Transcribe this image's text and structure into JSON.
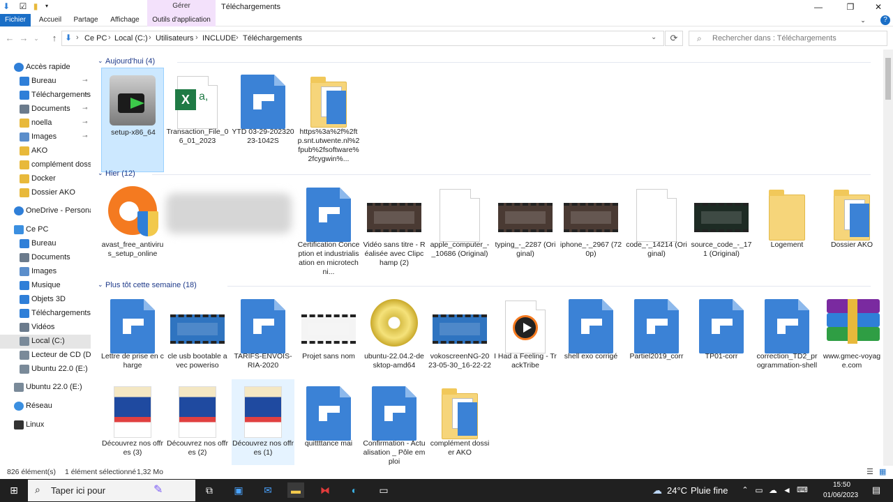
{
  "window": {
    "title": "Téléchargements",
    "context_group": "Gérer",
    "controls": {
      "minimize": "—",
      "maximize": "❐",
      "close": "✕"
    }
  },
  "ribbon": {
    "tabs": [
      "Fichier",
      "Accueil",
      "Partage",
      "Affichage",
      "Outils d'application"
    ],
    "help": "?"
  },
  "address": {
    "crumbs": [
      "Ce PC",
      "Local (C:)",
      "Utilisateurs",
      "INCLUDE",
      "Téléchargements"
    ],
    "separator": "›",
    "search_placeholder": "Rechercher dans : Téléchargements"
  },
  "sidebar": {
    "items": [
      {
        "label": "Accès rapide",
        "icon": "star-icon",
        "color": "#2f7fd8"
      },
      {
        "label": "Bureau",
        "icon": "desktop-icon",
        "color": "#2f7fd8",
        "pinned": true
      },
      {
        "label": "Téléchargements",
        "icon": "download-icon",
        "color": "#2f7fd8",
        "pinned": true
      },
      {
        "label": "Documents",
        "icon": "documents-icon",
        "color": "#6b7b8c",
        "pinned": true
      },
      {
        "label": "noella",
        "icon": "folder-icon",
        "color": "#e8b93b",
        "pinned": true
      },
      {
        "label": "Images",
        "icon": "images-icon",
        "color": "#5b8ecb",
        "pinned": true
      },
      {
        "label": "AKO",
        "icon": "folder-icon",
        "color": "#e8b93b"
      },
      {
        "label": "complément dossie",
        "icon": "folder-icon",
        "color": "#e8b93b"
      },
      {
        "label": "Docker",
        "icon": "folder-icon",
        "color": "#e8b93b"
      },
      {
        "label": "Dossier AKO",
        "icon": "folder-icon",
        "color": "#e8b93b"
      },
      {
        "label": "OneDrive - Personal",
        "icon": "cloud-icon",
        "color": "#2f7fd8"
      },
      {
        "label": "Ce PC",
        "icon": "computer-icon",
        "color": "#3b8fe0"
      },
      {
        "label": "Bureau",
        "icon": "desktop-icon",
        "color": "#2f7fd8"
      },
      {
        "label": "Documents",
        "icon": "documents-icon",
        "color": "#6b7b8c"
      },
      {
        "label": "Images",
        "icon": "images-icon",
        "color": "#5b8ecb"
      },
      {
        "label": "Musique",
        "icon": "music-icon",
        "color": "#2f7fd8"
      },
      {
        "label": "Objets 3D",
        "icon": "cube-icon",
        "color": "#2f7fd8"
      },
      {
        "label": "Téléchargements",
        "icon": "download-icon",
        "color": "#2f7fd8"
      },
      {
        "label": "Vidéos",
        "icon": "video-icon",
        "color": "#6b7b8c"
      },
      {
        "label": "Local (C:)",
        "icon": "drive-icon",
        "color": "#7a8a99",
        "selected": true
      },
      {
        "label": "Lecteur de CD (D:)",
        "icon": "cd-drive-icon",
        "color": "#7a8a99"
      },
      {
        "label": "Ubuntu 22.0 (E:)",
        "icon": "usb-drive-icon",
        "color": "#7a8a99"
      },
      {
        "label": "Ubuntu 22.0 (E:)",
        "icon": "usb-drive-icon",
        "color": "#7a8a99"
      },
      {
        "label": "Réseau",
        "icon": "network-icon",
        "color": "#3b8fe0"
      },
      {
        "label": "Linux",
        "icon": "penguin-icon",
        "color": "#333333"
      }
    ],
    "pin_glyph": "📌"
  },
  "groups": [
    {
      "label": "Aujourd'hui (4)",
      "items": [
        {
          "name": "setup-x86_64",
          "type": "cygwin-setup",
          "selected": true
        },
        {
          "name": "Transaction_File_06_01_2023",
          "type": "excel"
        },
        {
          "name": "YTD 03-29-20232023-1042S",
          "type": "doc-blue"
        },
        {
          "name": "https%3a%2f%2ftp.snt.utwente.nl%2fpub%2fsoftware%2fcygwin%...",
          "type": "folder-docs"
        }
      ]
    },
    {
      "label": "Hier (12)",
      "items": [
        {
          "name": "avast_free_antivirus_setup_online",
          "type": "avast"
        },
        {
          "name": "",
          "type": "blurred"
        },
        {
          "name": "Certification Conception et industrialisation en microtechni...",
          "type": "doc-blue"
        },
        {
          "name": "Vidéo sans titre - Réalisée avec Clipchamp (2)",
          "type": "video"
        },
        {
          "name": "apple_computer_-_10686 (Original)",
          "type": "doc-white"
        },
        {
          "name": "typing_-_2287 (Original)",
          "type": "video"
        },
        {
          "name": "iphone_-_2967 (720p)",
          "type": "video"
        },
        {
          "name": "code_-_14214 (Original)",
          "type": "doc-white"
        },
        {
          "name": "source_code_-_171 (Original)",
          "type": "video-dark"
        },
        {
          "name": "Logement",
          "type": "folder"
        },
        {
          "name": "Dossier AKO",
          "type": "folder-docs"
        }
      ]
    },
    {
      "label": "Plus tôt cette semaine (18)",
      "items": [
        {
          "name": "Lettre de prise en charge",
          "type": "doc-blue"
        },
        {
          "name": "cle usb bootable avec poweriso",
          "type": "video-screen"
        },
        {
          "name": "TARIFS-ENVOIS-RIA-2020",
          "type": "doc-blue"
        },
        {
          "name": "Projet sans nom",
          "type": "video-white"
        },
        {
          "name": "ubuntu-22.04.2-desktop-amd64",
          "type": "disc"
        },
        {
          "name": "vokoscreenNG-2023-05-30_16-22-22",
          "type": "video-screen"
        },
        {
          "name": "I Had a Feeling - TrackTribe",
          "type": "media"
        },
        {
          "name": "shell exo corrigé",
          "type": "doc-blue"
        },
        {
          "name": "Partiel2019_corr",
          "type": "doc-blue"
        },
        {
          "name": "TP01-corr",
          "type": "doc-blue"
        },
        {
          "name": "correction_TD2_programmation-shell",
          "type": "doc-blue"
        },
        {
          "name": "www.gmec-voyage.com",
          "type": "winrar"
        },
        {
          "name": "Découvrez nos offres (3)",
          "type": "poster"
        },
        {
          "name": "Découvrez nos offres (2)",
          "type": "poster"
        },
        {
          "name": "Découvrez nos offres (1)",
          "type": "poster",
          "hovered": true
        },
        {
          "name": "quittttance mai",
          "type": "doc-blue"
        },
        {
          "name": "Confirmation - Actualisation _ Pôle emploi",
          "type": "doc-blue"
        },
        {
          "name": "complément dossier AKO",
          "type": "folder-docs"
        }
      ]
    }
  ],
  "status": {
    "count": "826 élément(s)",
    "selection": "1 élément sélectionné",
    "size": "1,32 Mo"
  },
  "taskbar": {
    "search_placeholder": "Taper ici pour",
    "weather_temp": "24°C",
    "weather_text": "Pluie fine",
    "time": "15:50",
    "date": "01/06/2023"
  }
}
